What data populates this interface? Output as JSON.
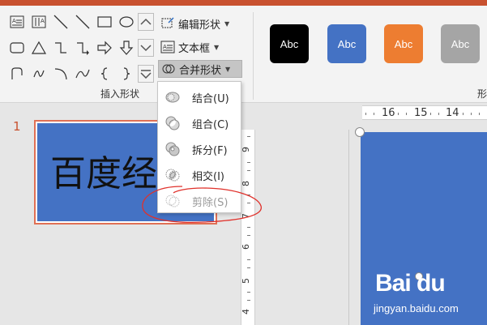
{
  "ribbon": {
    "insert_shapes_group_label": "插入形状",
    "edit_shape_label": "编辑形状",
    "text_box_label": "文本框",
    "merge_shapes_label": "合并形状",
    "shape_styles_group_label_partial": "形",
    "style_swatches": [
      {
        "label": "Abc",
        "color": "#000000"
      },
      {
        "label": "Abc",
        "color": "#4472c4"
      },
      {
        "label": "Abc",
        "color": "#ed7d31"
      },
      {
        "label": "Abc",
        "color": "#a5a5a5"
      }
    ]
  },
  "merge_menu": {
    "items": [
      {
        "label": "结合(U)",
        "enabled": true
      },
      {
        "label": "组合(C)",
        "enabled": true
      },
      {
        "label": "拆分(F)",
        "enabled": true
      },
      {
        "label": "相交(I)",
        "enabled": true
      },
      {
        "label": "剪除(S)",
        "enabled": false
      }
    ]
  },
  "thumbnails": {
    "slide_number": "1",
    "slide_text": "百度经"
  },
  "vertical_ruler": [
    "9",
    "8",
    "7",
    "6",
    "5",
    "4"
  ],
  "horizontal_ruler": [
    "16",
    "15",
    "14"
  ],
  "watermark": {
    "logo": "Bai du",
    "url": "jingyan.baidu.com"
  },
  "colors": {
    "accent": "#c8512f",
    "slide_fill": "#4472c4"
  }
}
